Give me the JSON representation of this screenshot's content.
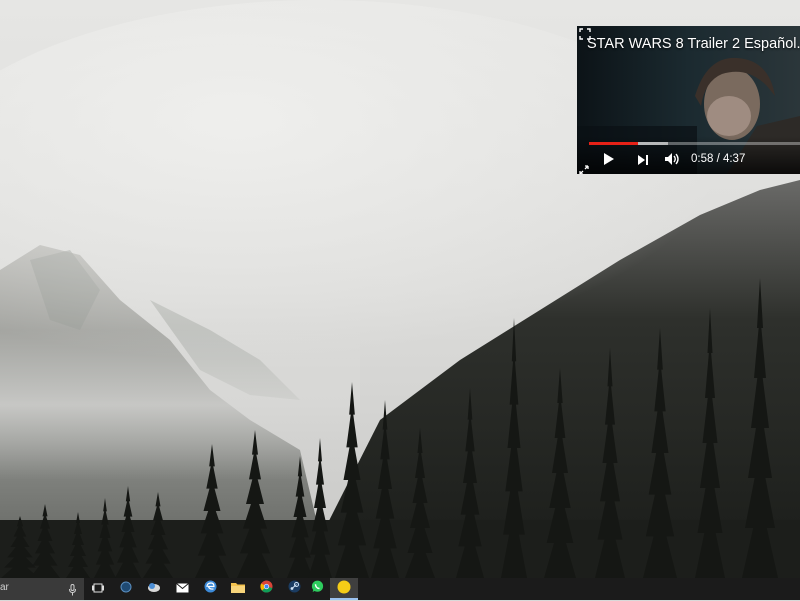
{
  "video": {
    "title": "STAR WARS 8 Trailer 2 Español...",
    "current_time": "0:58",
    "duration": "4:37",
    "time_display": "0:58 / 4:37",
    "progress_fraction": 0.23,
    "buffered_fraction": 0.375,
    "accent_color": "#e62117"
  },
  "taskbar": {
    "search_text": "ar",
    "icons": [
      "task-view-icon",
      "app-circle-icon",
      "weather-app-icon",
      "mail-icon",
      "edge-browser-icon",
      "file-explorer-icon",
      "chrome-icon",
      "steam-icon",
      "whatsapp-icon",
      "sticky-note-icon"
    ],
    "active_item": "sticky-note-icon",
    "background_color": "#1b1b1b"
  }
}
